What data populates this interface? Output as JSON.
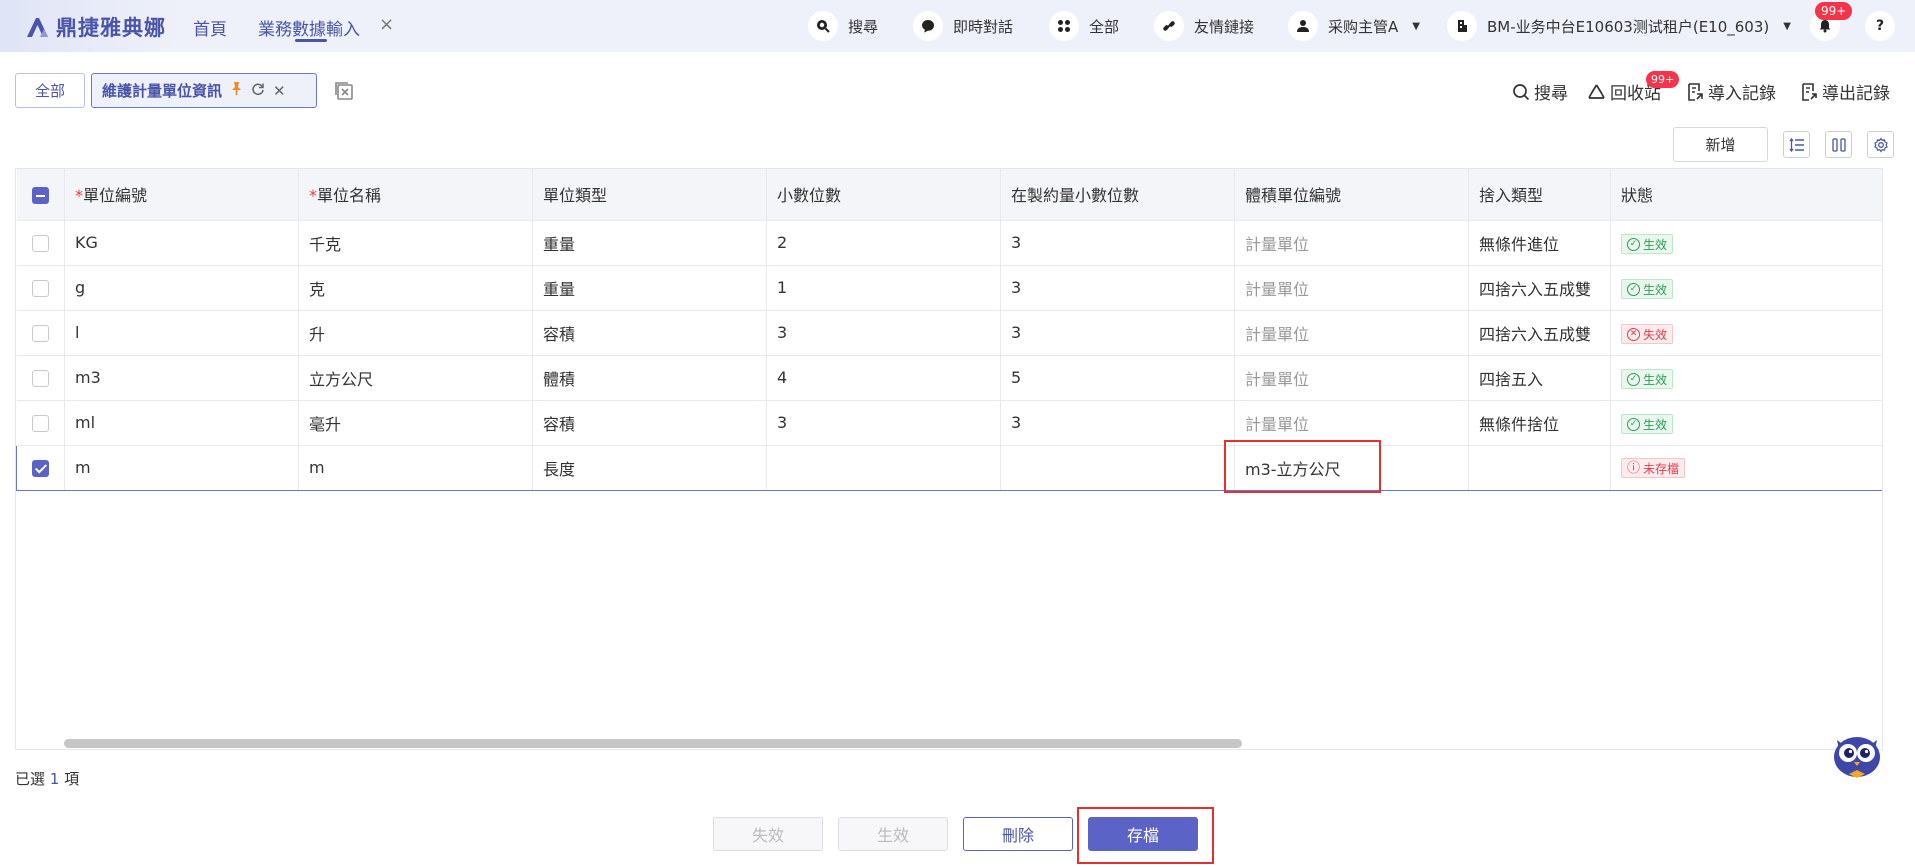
{
  "brand": {
    "name": "鼎捷雅典娜"
  },
  "nav": {
    "home": "首頁",
    "current_tab": "業務數據輸入",
    "close": "×"
  },
  "topbar": {
    "search": "搜尋",
    "chat": "即時對話",
    "all": "全部",
    "links": "友情鏈接",
    "user": "采购主管A",
    "tenant": "BM-业务中台E10603测试租户(E10_603)",
    "notification_badge": "99+"
  },
  "tabs": {
    "all": "全部",
    "active": "維護計量單位資訊"
  },
  "tools": {
    "search": "搜尋",
    "recycle": "回收站",
    "recycle_badge": "99+",
    "import": "導入記錄",
    "export": "導出記錄",
    "add": "新增"
  },
  "table": {
    "headers": [
      "單位編號",
      "單位名稱",
      "單位類型",
      "小數位數",
      "在製約量小數位數",
      "體積單位編號",
      "捨入類型",
      "狀態"
    ],
    "required_mark": "*",
    "rows": [
      {
        "code": "KG",
        "name": "千克",
        "type": "重量",
        "decimals": "2",
        "wip_decimals": "3",
        "volume_unit": "計量單位",
        "rounding": "無條件進位",
        "status": "生效",
        "status_kind": "ok"
      },
      {
        "code": "g",
        "name": "克",
        "type": "重量",
        "decimals": "1",
        "wip_decimals": "3",
        "volume_unit": "計量單位",
        "rounding": "四捨六入五成雙",
        "status": "生效",
        "status_kind": "ok"
      },
      {
        "code": "l",
        "name": "升",
        "type": "容積",
        "decimals": "3",
        "wip_decimals": "3",
        "volume_unit": "計量單位",
        "rounding": "四捨六入五成雙",
        "status": "失效",
        "status_kind": "bad"
      },
      {
        "code": "m3",
        "name": "立方公尺",
        "type": "體積",
        "decimals": "4",
        "wip_decimals": "5",
        "volume_unit": "計量單位",
        "rounding": "四捨五入",
        "status": "生效",
        "status_kind": "ok"
      },
      {
        "code": "ml",
        "name": "毫升",
        "type": "容積",
        "decimals": "3",
        "wip_decimals": "3",
        "volume_unit": "計量單位",
        "rounding": "無條件捨位",
        "status": "生效",
        "status_kind": "ok"
      },
      {
        "code": "m",
        "name": "m",
        "type": "長度",
        "decimals": "",
        "wip_decimals": "",
        "volume_unit": "m3-立方公尺",
        "rounding": "",
        "status": "未存檔",
        "status_kind": "unsaved"
      }
    ]
  },
  "selection": {
    "prefix": "已選",
    "count": "1",
    "suffix": "項"
  },
  "footer": {
    "disable": "失效",
    "enable": "生效",
    "delete": "刪除",
    "save": "存檔"
  },
  "colors": {
    "accent": "#5b63c7",
    "highlight": "#e53030",
    "ok": "#2c9e52",
    "bad": "#e03d4e"
  }
}
